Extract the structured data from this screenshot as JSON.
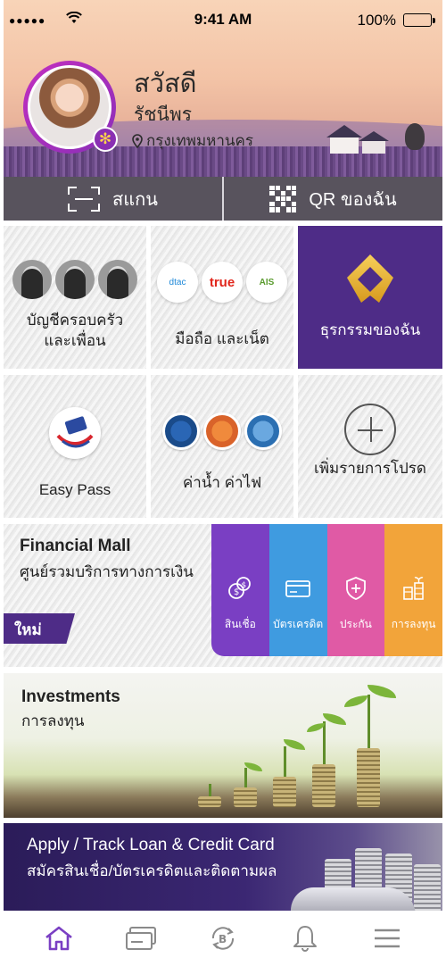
{
  "status_bar": {
    "signal": "●●●●●",
    "time": "9:41 AM",
    "battery": "100%"
  },
  "profile": {
    "greeting": "สวัสดี",
    "name": "รัชนีพร",
    "location": "กรุงเทพมหานคร"
  },
  "actions": {
    "scan_label": "สแกน",
    "qr_label": "QR ของฉัน"
  },
  "tiles": [
    {
      "label_line1": "บัญชีครอบครัว",
      "label_line2": "และเพื่อน"
    },
    {
      "label_line1": "มือถือ และเน็ต",
      "label_line2": "",
      "operators": [
        "dtac",
        "true",
        "AIS"
      ]
    },
    {
      "label_line1": "ธุรกรรมของฉัน",
      "label_line2": ""
    },
    {
      "label_line1": "Easy Pass",
      "label_line2": ""
    },
    {
      "label_line1": "ค่าน้ำ ค่าไฟ",
      "label_line2": ""
    },
    {
      "label_line1": "เพิ่มรายการโปรด",
      "label_line2": ""
    }
  ],
  "financial_mall": {
    "title": "Financial Mall",
    "subtitle": "ศูนย์รวมบริการทางการเงิน",
    "badge": "ใหม่",
    "categories": [
      {
        "label": "สินเชื่อ",
        "color": "#7a3fc3"
      },
      {
        "label": "บัตรเครดิต",
        "color": "#3f9be0"
      },
      {
        "label": "ประกัน",
        "color": "#e05aa5"
      },
      {
        "label": "การลงทุน",
        "color": "#f2a43a"
      }
    ]
  },
  "investments": {
    "title": "Investments",
    "subtitle": "การลงทุน"
  },
  "loan_banner": {
    "title": "Apply / Track Loan & Credit Card",
    "subtitle": "สมัครสินเชื่อ/บัตรเครดิตและติดตามผล"
  },
  "bottom_nav": {
    "items": [
      "home-icon",
      "card-icon",
      "transfer-icon",
      "bell-icon",
      "menu-icon"
    ],
    "active_color": "#7a3fc3",
    "inactive_color": "#8a8a8a"
  }
}
